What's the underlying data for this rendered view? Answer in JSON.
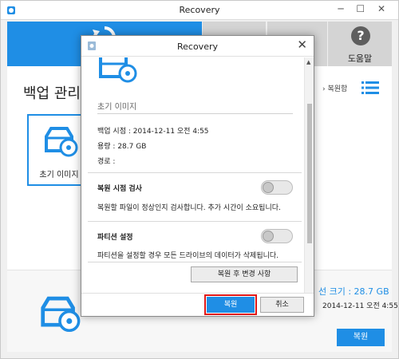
{
  "main_window": {
    "title": "Recovery",
    "window_controls": "─ ☐ ✕",
    "toolbar": {
      "help_label": "도움말"
    },
    "heading": "백업 관리",
    "right_text": "› 복원함",
    "backup_card_label": "초기 이미지",
    "bottom": {
      "size_text": "선 크기 : 28.7 GB",
      "date_text": "2014-12-11 오전 4:55",
      "restore_button": "복원"
    }
  },
  "dialog": {
    "title": "Recovery",
    "close_glyph": "✕",
    "image_label": "초기 이미지",
    "backup_time": "백업 시점 : 2014-12-11 오전 4:55",
    "capacity": "용량 : 28.7 GB",
    "path": "경로 :",
    "sections": [
      {
        "title": "복원 시점 검사",
        "description": "복원할 파일이 정상인지 검사합니다. 추가 시간이 소요됩니다.",
        "toggle_on": false
      },
      {
        "title": "파티션 설정",
        "description": "파티션을 설정할 경우 모든 드라이브의 데이터가 삭제됩니다.",
        "toggle_on": false
      }
    ],
    "changes_button": "복원 후 변경 사항",
    "ok_button": "복원",
    "cancel_button": "취소"
  },
  "colors": {
    "accent": "#1f8ee5",
    "highlight": "#e01818",
    "toolbar_grey": "#d4d4d4"
  },
  "icons": [
    "app-icon",
    "restore-icon",
    "help-icon",
    "list-view-icon",
    "car-restore-icon",
    "close-icon",
    "scroll-up-icon"
  ]
}
